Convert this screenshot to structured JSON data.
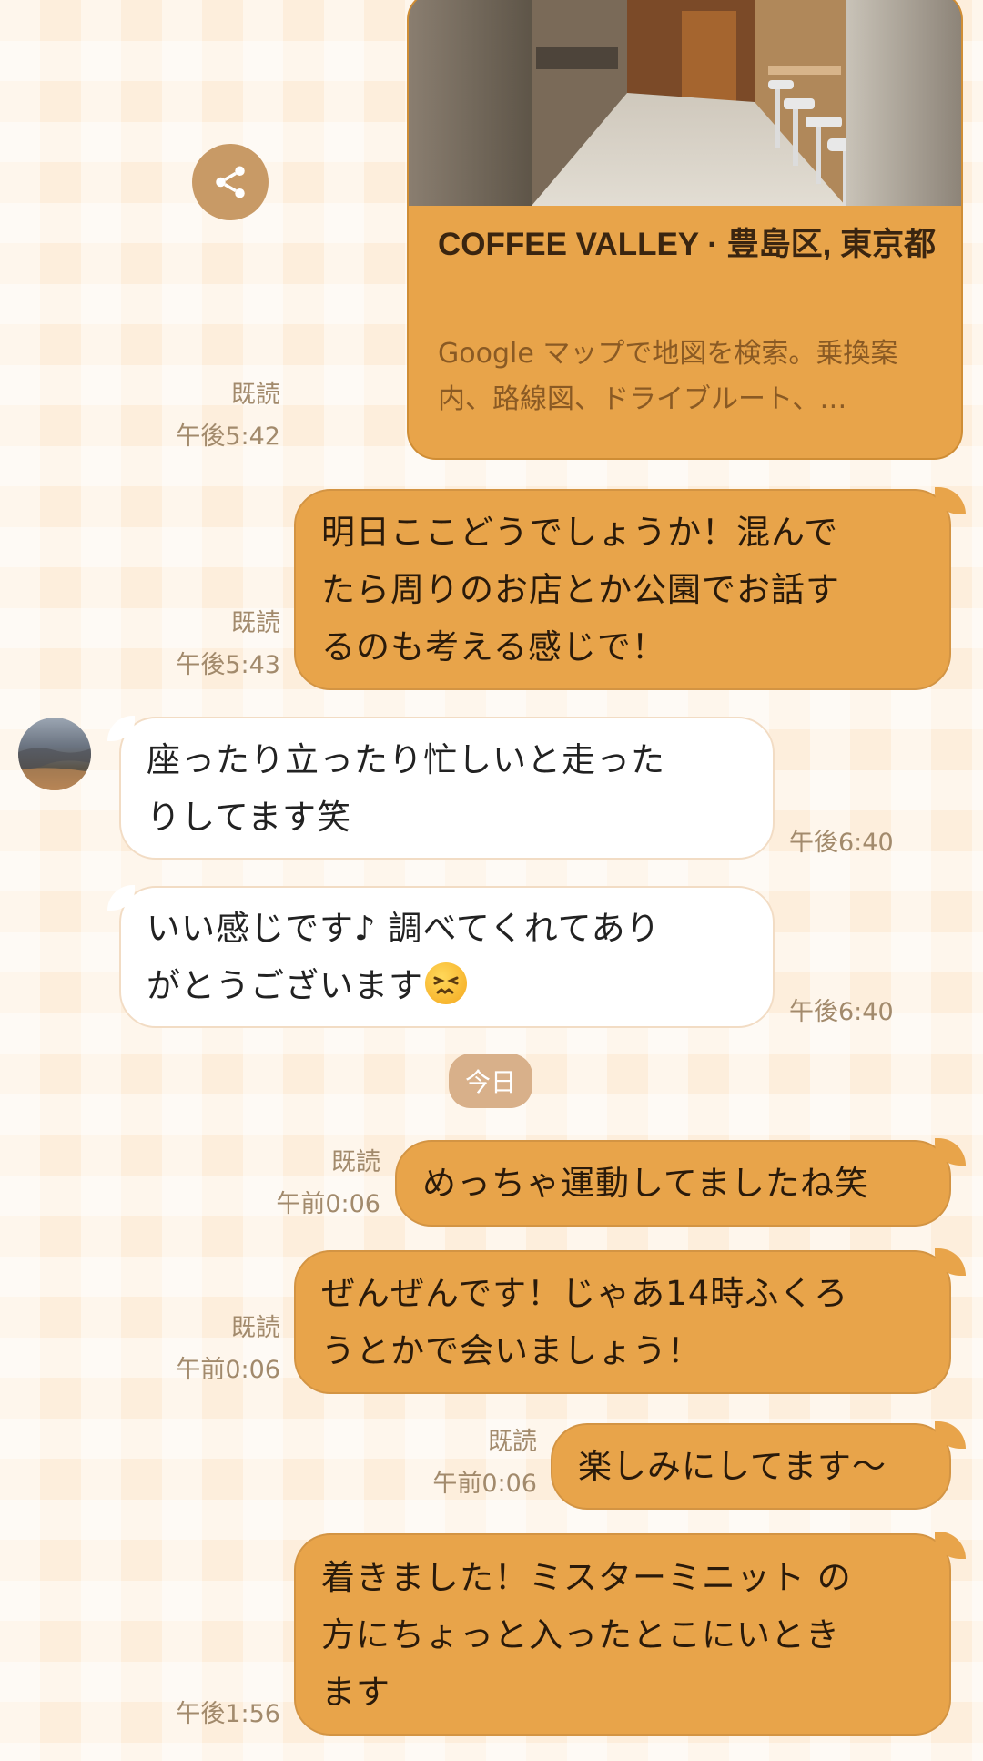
{
  "link_card": {
    "title": "COFFEE VALLEY · 豊島区, 東京都",
    "description": "Google マップで地図を検索。乗換案内、路線図、ドライブルート、…",
    "read_label": "既読",
    "time": "午後5:42"
  },
  "messages": [
    {
      "id": "m1",
      "direction": "out",
      "text_lines": [
        "明日ここどうでしょうか！混んで",
        "たら周りのお店とか公園でお話す",
        "るのも考える感じで！"
      ],
      "read_label": "既読",
      "time": "午後5:43"
    },
    {
      "id": "m2",
      "direction": "in",
      "text_lines": [
        "座ったり立ったり忙しいと走った",
        "りしてます笑"
      ],
      "time": "午後6:40"
    },
    {
      "id": "m3",
      "direction": "in",
      "text_lines": [
        "いい感じです♪ 調べてくれてあり",
        "がとうございます"
      ],
      "emoji": "persevering-face",
      "time": "午後6:40"
    },
    {
      "id": "m4",
      "direction": "out",
      "text_lines": [
        "めっちゃ運動してましたね笑"
      ],
      "read_label": "既読",
      "time": "午前0:06"
    },
    {
      "id": "m5",
      "direction": "out",
      "text_lines": [
        "ぜんぜんです！じゃあ14時ふくろ",
        "うとかで会いましょう！"
      ],
      "read_label": "既読",
      "time": "午前0:06"
    },
    {
      "id": "m6",
      "direction": "out",
      "text_lines": [
        "楽しみにしてます〜"
      ],
      "read_label": "既読",
      "time": "午前0:06"
    },
    {
      "id": "m7",
      "direction": "out",
      "text_lines": [
        "着きました！ミスターミニット の",
        "方にちょっと入ったとこにいとき",
        "ます"
      ],
      "time": "午後1:56"
    }
  ],
  "date_separator": "今日",
  "icons": {
    "share": "share-icon",
    "avatar": "contact-avatar"
  },
  "colors": {
    "bubble_out": "#e8a44a",
    "bubble_in": "#ffffff",
    "background": "#fdeedc",
    "meta_text": "#a28a6c"
  }
}
